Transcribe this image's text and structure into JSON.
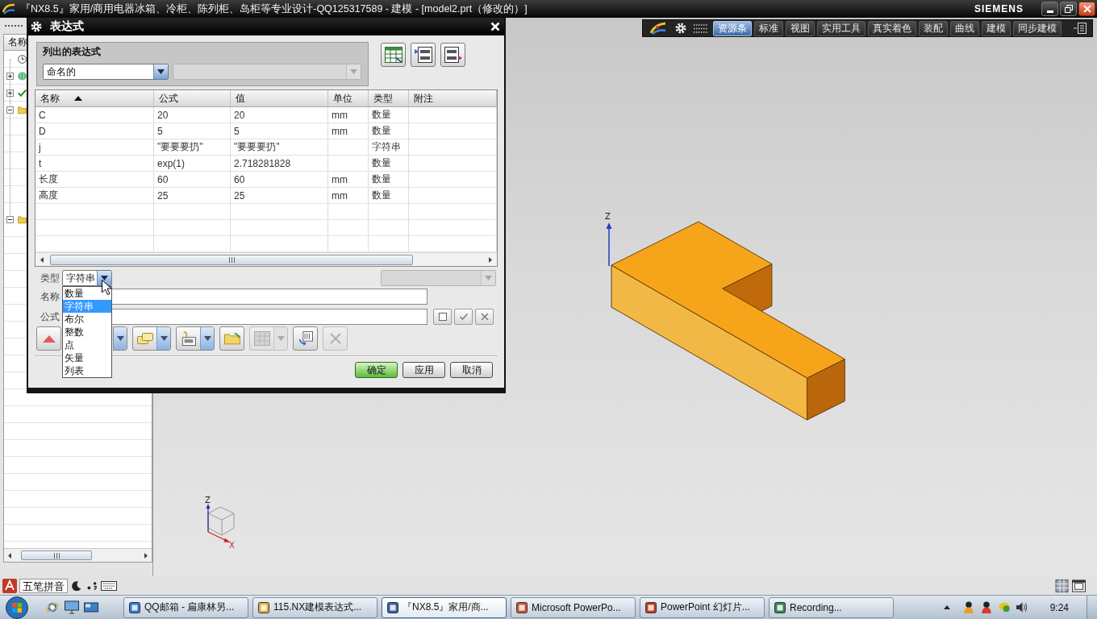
{
  "window": {
    "title": "『NX8.5』家用/商用电器冰箱、冷柜、陈列柜、岛柜等专业设计-QQ125317589 - 建模 - [model2.prt（修改的）]",
    "brand": "SIEMENS"
  },
  "toolbar": {
    "tabs": [
      {
        "label": "资源条",
        "selected": true
      },
      {
        "label": "标准",
        "selected": false
      },
      {
        "label": "视图",
        "selected": false
      },
      {
        "label": "实用工具",
        "selected": false
      },
      {
        "label": "真实着色",
        "selected": false
      },
      {
        "label": "装配",
        "selected": false
      },
      {
        "label": "曲线",
        "selected": false
      },
      {
        "label": "建模",
        "selected": false
      },
      {
        "label": "同步建模",
        "selected": false
      }
    ]
  },
  "navigator": {
    "header": "名称",
    "items": [
      {
        "kind": "clock"
      },
      {
        "kind": "globe",
        "expanded": false
      },
      {
        "kind": "check",
        "expanded": false
      },
      {
        "kind": "folder",
        "expanded": true
      },
      {
        "kind": "folder",
        "expanded": true
      }
    ]
  },
  "dialog": {
    "title": "表达式",
    "listed": {
      "label": "列出的表达式",
      "filter": "命名的",
      "extra_select": {
        "disabled": true
      }
    },
    "table": {
      "columns": [
        {
          "label": "名称",
          "sorted": true
        },
        {
          "label": "公式",
          "sorted": false
        },
        {
          "label": "值",
          "sorted": false
        },
        {
          "label": "单位",
          "sorted": false
        },
        {
          "label": "类型",
          "sorted": false
        },
        {
          "label": "附注",
          "sorted": false
        }
      ],
      "rows": [
        {
          "name": "C",
          "formula": "20",
          "value": "20",
          "unit": "mm",
          "type": "数量"
        },
        {
          "name": "D",
          "formula": "5",
          "value": "5",
          "unit": "mm",
          "type": "数量"
        },
        {
          "name": "j",
          "formula": "\"要要要扔\"",
          "value": "\"要要要扔\"",
          "type": "字符串"
        },
        {
          "name": "t",
          "formula": "exp(1)",
          "value": "2.718281828",
          "type": "数量"
        },
        {
          "name": "长度",
          "formula": "60",
          "value": "60",
          "unit": "mm",
          "type": "数量"
        },
        {
          "name": "高度",
          "formula": "25",
          "value": "25",
          "unit": "mm",
          "type": "数量"
        }
      ]
    },
    "type_field": {
      "label": "类型",
      "value": "字符串",
      "extra_select": {
        "disabled": true
      },
      "options": [
        {
          "label": "数量",
          "selected": false
        },
        {
          "label": "字符串",
          "selected": true
        },
        {
          "label": "布尔",
          "selected": false
        },
        {
          "label": "整数",
          "selected": false
        },
        {
          "label": "点",
          "selected": false
        },
        {
          "label": "矢量",
          "selected": false
        },
        {
          "label": "列表",
          "selected": false
        }
      ]
    },
    "name_field": {
      "label": "名称"
    },
    "formula_field": {
      "label": "公式"
    },
    "tools": [
      {
        "dropdown": false,
        "disabled": false
      },
      {
        "dropdown": true,
        "disabled": false
      },
      {
        "dropdown": true,
        "disabled": false
      },
      {
        "dropdown": true,
        "disabled": false
      },
      {
        "dropdown": false,
        "disabled": false
      },
      {
        "dropdown": true,
        "disabled": true
      },
      {
        "dropdown": false,
        "disabled": false
      },
      {
        "dropdown": false,
        "disabled": true
      }
    ],
    "buttons": [
      {
        "label": "确定",
        "default": true
      },
      {
        "label": "应用",
        "default": false
      },
      {
        "label": "取消",
        "default": false
      }
    ]
  },
  "viewport": {
    "wcs_label": "Z",
    "triad_labels": [
      "Z",
      "X"
    ]
  },
  "ime": {
    "label": "五笔拼音"
  },
  "taskbar": {
    "tasks": [
      {
        "label": "QQ邮箱 - 扁康林另...",
        "selected": false
      },
      {
        "label": "115.NX建模表达式...",
        "selected": false
      },
      {
        "label": "『NX8.5』家用/商...",
        "selected": true
      },
      {
        "label": "Microsoft PowerPo...",
        "selected": false
      },
      {
        "label": "PowerPoint 幻灯片...",
        "selected": false
      },
      {
        "label": "Recording...",
        "selected": false
      }
    ],
    "clock": "9:24"
  }
}
